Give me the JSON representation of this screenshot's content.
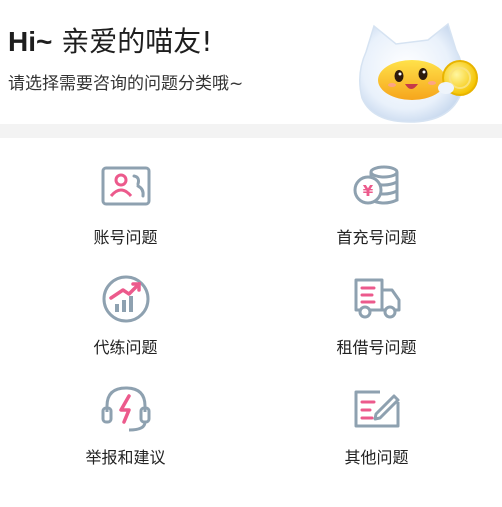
{
  "header": {
    "hi": "Hi~",
    "greeting": "亲爱的喵友!",
    "subtitle": "请选择需要咨询的问题分类哦~"
  },
  "categories": [
    {
      "label": "账号问题",
      "icon": "account-card-icon"
    },
    {
      "label": "首充号问题",
      "icon": "coin-stack-icon"
    },
    {
      "label": "代练问题",
      "icon": "growth-chart-icon"
    },
    {
      "label": "租借号问题",
      "icon": "delivery-truck-icon"
    },
    {
      "label": "举报和建议",
      "icon": "headset-icon"
    },
    {
      "label": "其他问题",
      "icon": "edit-note-icon"
    }
  ],
  "colors": {
    "icon_stroke": "#8ea1b0",
    "accent_pink": "#ec5a8c",
    "divider": "#f3f3f3"
  }
}
